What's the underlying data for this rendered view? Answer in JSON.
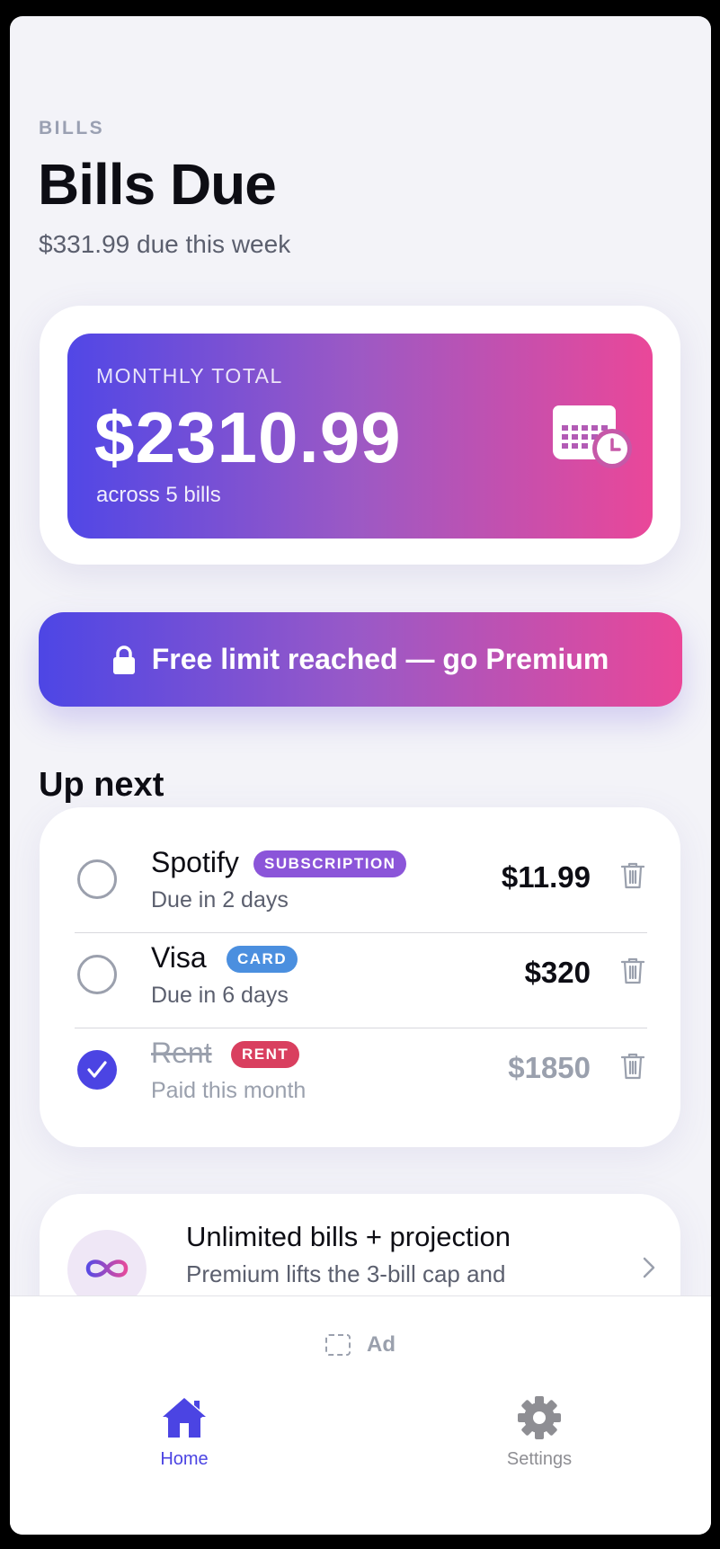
{
  "header": {
    "eyebrow": "BILLS",
    "title": "Bills Due",
    "subtitle": "$331.99 due this week"
  },
  "summary": {
    "label": "MONTHLY TOTAL",
    "amount": "$2310.99",
    "count_text": "across 5 bills",
    "icon": "calendar-clock-icon"
  },
  "premium_button": {
    "label": "Free limit reached — go Premium",
    "icon": "lock-icon"
  },
  "section": {
    "title": "Up next"
  },
  "bills": [
    {
      "name": "Spotify",
      "badge": "SUBSCRIPTION",
      "badge_color": "#8b55d9",
      "due": "Due in 2 days",
      "amount": "$11.99",
      "paid": false
    },
    {
      "name": "Visa",
      "badge": "CARD",
      "badge_color": "#4b8fdf",
      "due": "Due in 6 days",
      "amount": "$320",
      "paid": false
    },
    {
      "name": "Rent",
      "badge": "RENT",
      "badge_color": "#d93f5f",
      "due": "Paid this month",
      "amount": "$1850",
      "paid": true
    }
  ],
  "promo": {
    "title": "Unlimited bills + projection",
    "subtitle": "Premium lifts the 3-bill cap and",
    "icon": "infinity-icon"
  },
  "ad": {
    "label": "Ad"
  },
  "tabs": [
    {
      "label": "Home",
      "icon": "home-icon",
      "active": true
    },
    {
      "label": "Settings",
      "icon": "gear-icon",
      "active": false
    }
  ],
  "colors": {
    "accent": "#4b44e3",
    "gradient_start": "#5147e6",
    "gradient_end": "#ea4799"
  }
}
